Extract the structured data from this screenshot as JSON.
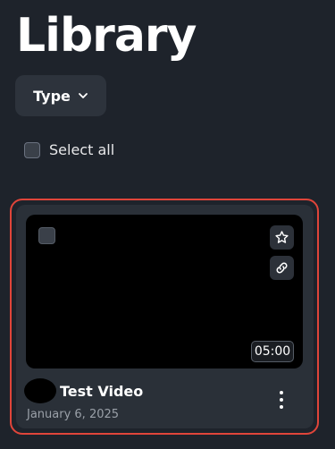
{
  "header": {
    "title": "Library"
  },
  "filters": {
    "type_label": "Type"
  },
  "selection": {
    "select_all_label": "Select all"
  },
  "video_card": {
    "title": "Test Video",
    "date": "January 6, 2025",
    "duration": "05:00",
    "icons": [
      "star-icon",
      "link-icon",
      "more-vertical-icon",
      "chevron-down-icon"
    ]
  },
  "colors": {
    "background": "#1e232b",
    "card": "#2a3038",
    "highlight": "#e0453a"
  }
}
